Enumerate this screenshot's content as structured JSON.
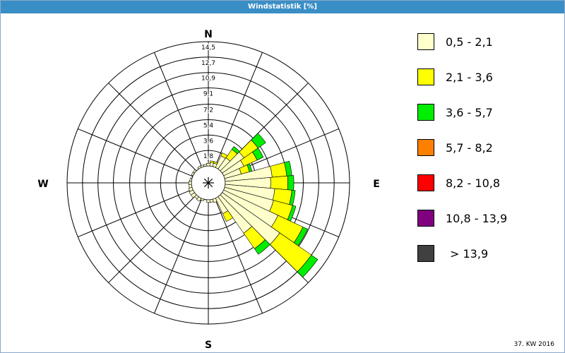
{
  "header": {
    "title": "Windstatistik [%]"
  },
  "footer": {
    "week": "37. KW 2016"
  },
  "chart_data": {
    "type": "wind-rose",
    "title": "Windstatistik [%]",
    "compass": [
      "N",
      "E",
      "S",
      "W"
    ],
    "radial_ticks": [
      "1,8",
      "3,6",
      "5,4",
      "7,2",
      "9,1",
      "10,9",
      "12,7",
      "14,5"
    ],
    "radial_max": 14.5,
    "sectors": 36,
    "legend": [
      {
        "label": "0,5 - 2,1",
        "color": "#ffffcc"
      },
      {
        "label": "2,1 - 3,6",
        "color": "#ffff00"
      },
      {
        "label": "3,6 - 5,7",
        "color": "#00ee00"
      },
      {
        "label": "5,7 - 8,2",
        "color": "#ff8000"
      },
      {
        "label": "8,2 - 10,8",
        "color": "#ff0000"
      },
      {
        "label": "10,8 - 13,9",
        "color": "#800080"
      },
      {
        "label": "> 13,9",
        "color": "#404040"
      }
    ],
    "direction_data": [
      {
        "dir": 0,
        "values": [
          0.3,
          0,
          0,
          0,
          0,
          0,
          0
        ]
      },
      {
        "dir": 10,
        "values": [
          0.4,
          0.2,
          0,
          0,
          0,
          0,
          0
        ]
      },
      {
        "dir": 20,
        "values": [
          0.4,
          0.2,
          0,
          0,
          0,
          0,
          0
        ]
      },
      {
        "dir": 30,
        "values": [
          1.5,
          0.4,
          0,
          0,
          0,
          0,
          0
        ]
      },
      {
        "dir": 40,
        "values": [
          1.6,
          1.2,
          0.4,
          0,
          0,
          0,
          0
        ]
      },
      {
        "dir": 50,
        "values": [
          3.1,
          2.0,
          1.1,
          0,
          0,
          0,
          0
        ]
      },
      {
        "dir": 60,
        "values": [
          2.6,
          1.7,
          0.8,
          0,
          0,
          0,
          0
        ]
      },
      {
        "dir": 70,
        "values": [
          2.0,
          1.0,
          0.3,
          0,
          0,
          0,
          0
        ]
      },
      {
        "dir": 80,
        "values": [
          5.5,
          1.7,
          0.6,
          0,
          0,
          0,
          0
        ]
      },
      {
        "dir": 90,
        "values": [
          5.3,
          2.0,
          0.7,
          0,
          0,
          0,
          0
        ]
      },
      {
        "dir": 100,
        "values": [
          5.8,
          2.0,
          0.4,
          0,
          0,
          0,
          0
        ]
      },
      {
        "dir": 110,
        "values": [
          5.9,
          2.3,
          0.4,
          0,
          0,
          0,
          0
        ]
      },
      {
        "dir": 120,
        "values": [
          7.0,
          3.2,
          0.6,
          0,
          0,
          0,
          0
        ]
      },
      {
        "dir": 130,
        "values": [
          8.2,
          4.5,
          0.9,
          0,
          0,
          0,
          0
        ]
      },
      {
        "dir": 140,
        "values": [
          5.2,
          2.2,
          0.8,
          0,
          0,
          0,
          0
        ]
      },
      {
        "dir": 150,
        "values": [
          2.0,
          1.0,
          0,
          0,
          0,
          0,
          0
        ]
      },
      {
        "dir": 160,
        "values": [
          0.4,
          0,
          0,
          0,
          0,
          0,
          0
        ]
      },
      {
        "dir": 170,
        "values": [
          0.3,
          0,
          0,
          0,
          0,
          0,
          0
        ]
      },
      {
        "dir": 180,
        "values": [
          0.3,
          0,
          0,
          0,
          0,
          0,
          0
        ]
      },
      {
        "dir": 190,
        "values": [
          0,
          0,
          0,
          0,
          0,
          0,
          0
        ]
      },
      {
        "dir": 200,
        "values": [
          0.2,
          0,
          0,
          0,
          0,
          0,
          0
        ]
      },
      {
        "dir": 210,
        "values": [
          0.4,
          0,
          0,
          0,
          0,
          0,
          0
        ]
      },
      {
        "dir": 220,
        "values": [
          0.3,
          0,
          0,
          0,
          0,
          0,
          0
        ]
      },
      {
        "dir": 230,
        "values": [
          0.5,
          0,
          0,
          0,
          0,
          0,
          0
        ]
      },
      {
        "dir": 240,
        "values": [
          0.5,
          0,
          0,
          0,
          0,
          0,
          0
        ]
      },
      {
        "dir": 250,
        "values": [
          0.4,
          0,
          0,
          0,
          0,
          0,
          0
        ]
      },
      {
        "dir": 260,
        "values": [
          0.3,
          0,
          0,
          0,
          0,
          0,
          0
        ]
      },
      {
        "dir": 270,
        "values": [
          0.3,
          0,
          0,
          0,
          0,
          0,
          0
        ]
      },
      {
        "dir": 280,
        "values": [
          0.2,
          0,
          0,
          0,
          0,
          0,
          0
        ]
      },
      {
        "dir": 290,
        "values": [
          0,
          0,
          0,
          0,
          0,
          0,
          0
        ]
      },
      {
        "dir": 300,
        "values": [
          0.2,
          0,
          0,
          0,
          0,
          0,
          0
        ]
      },
      {
        "dir": 310,
        "values": [
          0.2,
          0,
          0,
          0,
          0,
          0,
          0
        ]
      },
      {
        "dir": 320,
        "values": [
          0,
          0,
          0,
          0,
          0,
          0,
          0
        ]
      },
      {
        "dir": 330,
        "values": [
          0.2,
          0,
          0,
          0,
          0,
          0,
          0
        ]
      },
      {
        "dir": 340,
        "values": [
          0.2,
          0,
          0,
          0,
          0,
          0,
          0
        ]
      },
      {
        "dir": 350,
        "values": [
          0.2,
          0,
          0,
          0,
          0,
          0,
          0
        ]
      }
    ]
  }
}
